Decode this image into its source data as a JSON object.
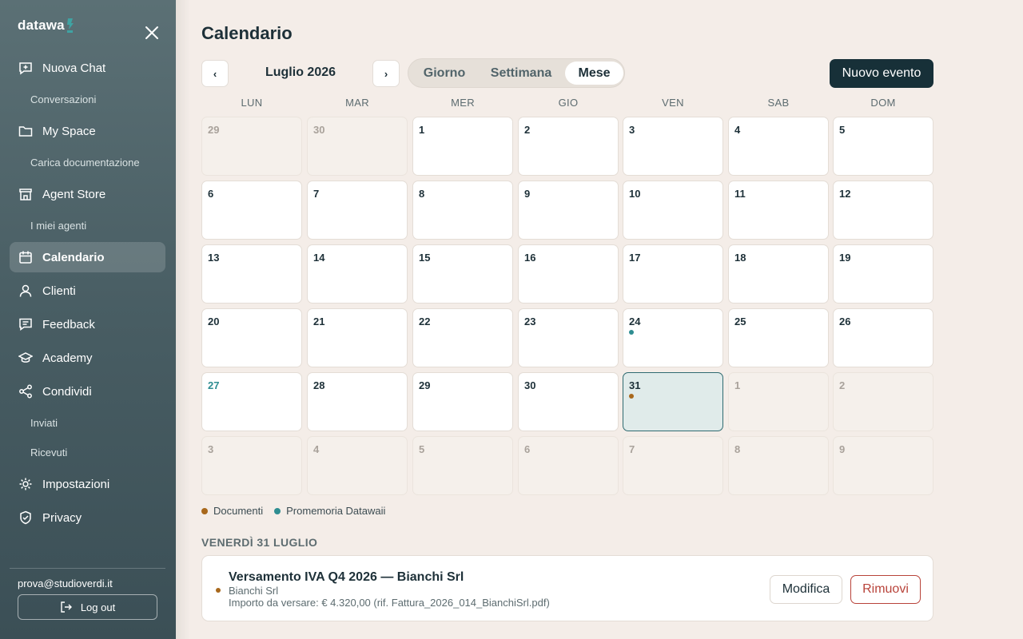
{
  "sidebar": {
    "logo_text": "datawa",
    "nav": [
      {
        "label": "Nuova Chat",
        "icon": "chat-plus-icon"
      },
      {
        "label": "Conversazioni",
        "sub": true
      },
      {
        "label": "My Space",
        "icon": "folder-icon"
      },
      {
        "label": "Carica documentazione",
        "sub": true
      },
      {
        "label": "Agent Store",
        "icon": "store-icon"
      },
      {
        "label": "I miei agenti",
        "sub": true
      },
      {
        "label": "Calendario",
        "icon": "calendar-icon",
        "active": true
      },
      {
        "label": "Clienti",
        "icon": "user-icon"
      },
      {
        "label": "Feedback",
        "icon": "feedback-icon"
      },
      {
        "label": "Academy",
        "icon": "graduation-cap-icon"
      },
      {
        "label": "Condividi",
        "icon": "share-icon"
      },
      {
        "label": "Inviati",
        "sub": true
      },
      {
        "label": "Ricevuti",
        "sub": true
      },
      {
        "label": "Impostazioni",
        "icon": "gear-icon"
      },
      {
        "label": "Privacy",
        "icon": "shield-check-icon"
      }
    ],
    "user_email": "prova@studioverdi.it",
    "logout_label": "Log out"
  },
  "header": {
    "title": "Calendario",
    "prev_label": "‹",
    "next_label": "›",
    "month_label": "Luglio 2026",
    "views": [
      {
        "label": "Giorno",
        "active": false
      },
      {
        "label": "Settimana",
        "active": false
      },
      {
        "label": "Mese",
        "active": true
      }
    ],
    "new_event_label": "Nuovo evento"
  },
  "calendar": {
    "weekdays": [
      "LUN",
      "MAR",
      "MER",
      "GIO",
      "VEN",
      "SAB",
      "DOM"
    ],
    "weeks": [
      [
        {
          "n": "29",
          "o": true
        },
        {
          "n": "30",
          "o": true
        },
        {
          "n": "1"
        },
        {
          "n": "2"
        },
        {
          "n": "3"
        },
        {
          "n": "4"
        },
        {
          "n": "5"
        }
      ],
      [
        {
          "n": "6"
        },
        {
          "n": "7"
        },
        {
          "n": "8"
        },
        {
          "n": "9"
        },
        {
          "n": "10"
        },
        {
          "n": "11"
        },
        {
          "n": "12"
        }
      ],
      [
        {
          "n": "13"
        },
        {
          "n": "14"
        },
        {
          "n": "15"
        },
        {
          "n": "16"
        },
        {
          "n": "17"
        },
        {
          "n": "18"
        },
        {
          "n": "19"
        }
      ],
      [
        {
          "n": "20"
        },
        {
          "n": "21"
        },
        {
          "n": "22"
        },
        {
          "n": "23"
        },
        {
          "n": "24",
          "dot": "promemoria"
        },
        {
          "n": "25"
        },
        {
          "n": "26"
        }
      ],
      [
        {
          "n": "27",
          "today": true
        },
        {
          "n": "28"
        },
        {
          "n": "29"
        },
        {
          "n": "30"
        },
        {
          "n": "31",
          "selected": true,
          "dot": "documenti"
        },
        {
          "n": "1",
          "o": true
        },
        {
          "n": "2",
          "o": true
        }
      ],
      [
        {
          "n": "3",
          "o": true
        },
        {
          "n": "4",
          "o": true
        },
        {
          "n": "5",
          "o": true
        },
        {
          "n": "6",
          "o": true
        },
        {
          "n": "7",
          "o": true
        },
        {
          "n": "8",
          "o": true
        },
        {
          "n": "9",
          "o": true
        }
      ]
    ]
  },
  "legend": [
    {
      "label": "Documenti",
      "key": "documenti",
      "color": "#a8681c"
    },
    {
      "label": "Promemoria Datawaii",
      "key": "promemoria",
      "color": "#2e8d91"
    }
  ],
  "selected_day": {
    "heading": "VENERDÌ 31 LUGLIO",
    "event": {
      "title": "Versamento IVA Q4 2026 — Bianchi Srl",
      "client": "Bianchi Srl",
      "description": "Importo da versare: € 4.320,00 (rif. Fattura_2026_014_BianchiSrl.pdf)",
      "color": "#a8681c",
      "edit_label": "Modifica",
      "remove_label": "Rimuovi"
    }
  }
}
